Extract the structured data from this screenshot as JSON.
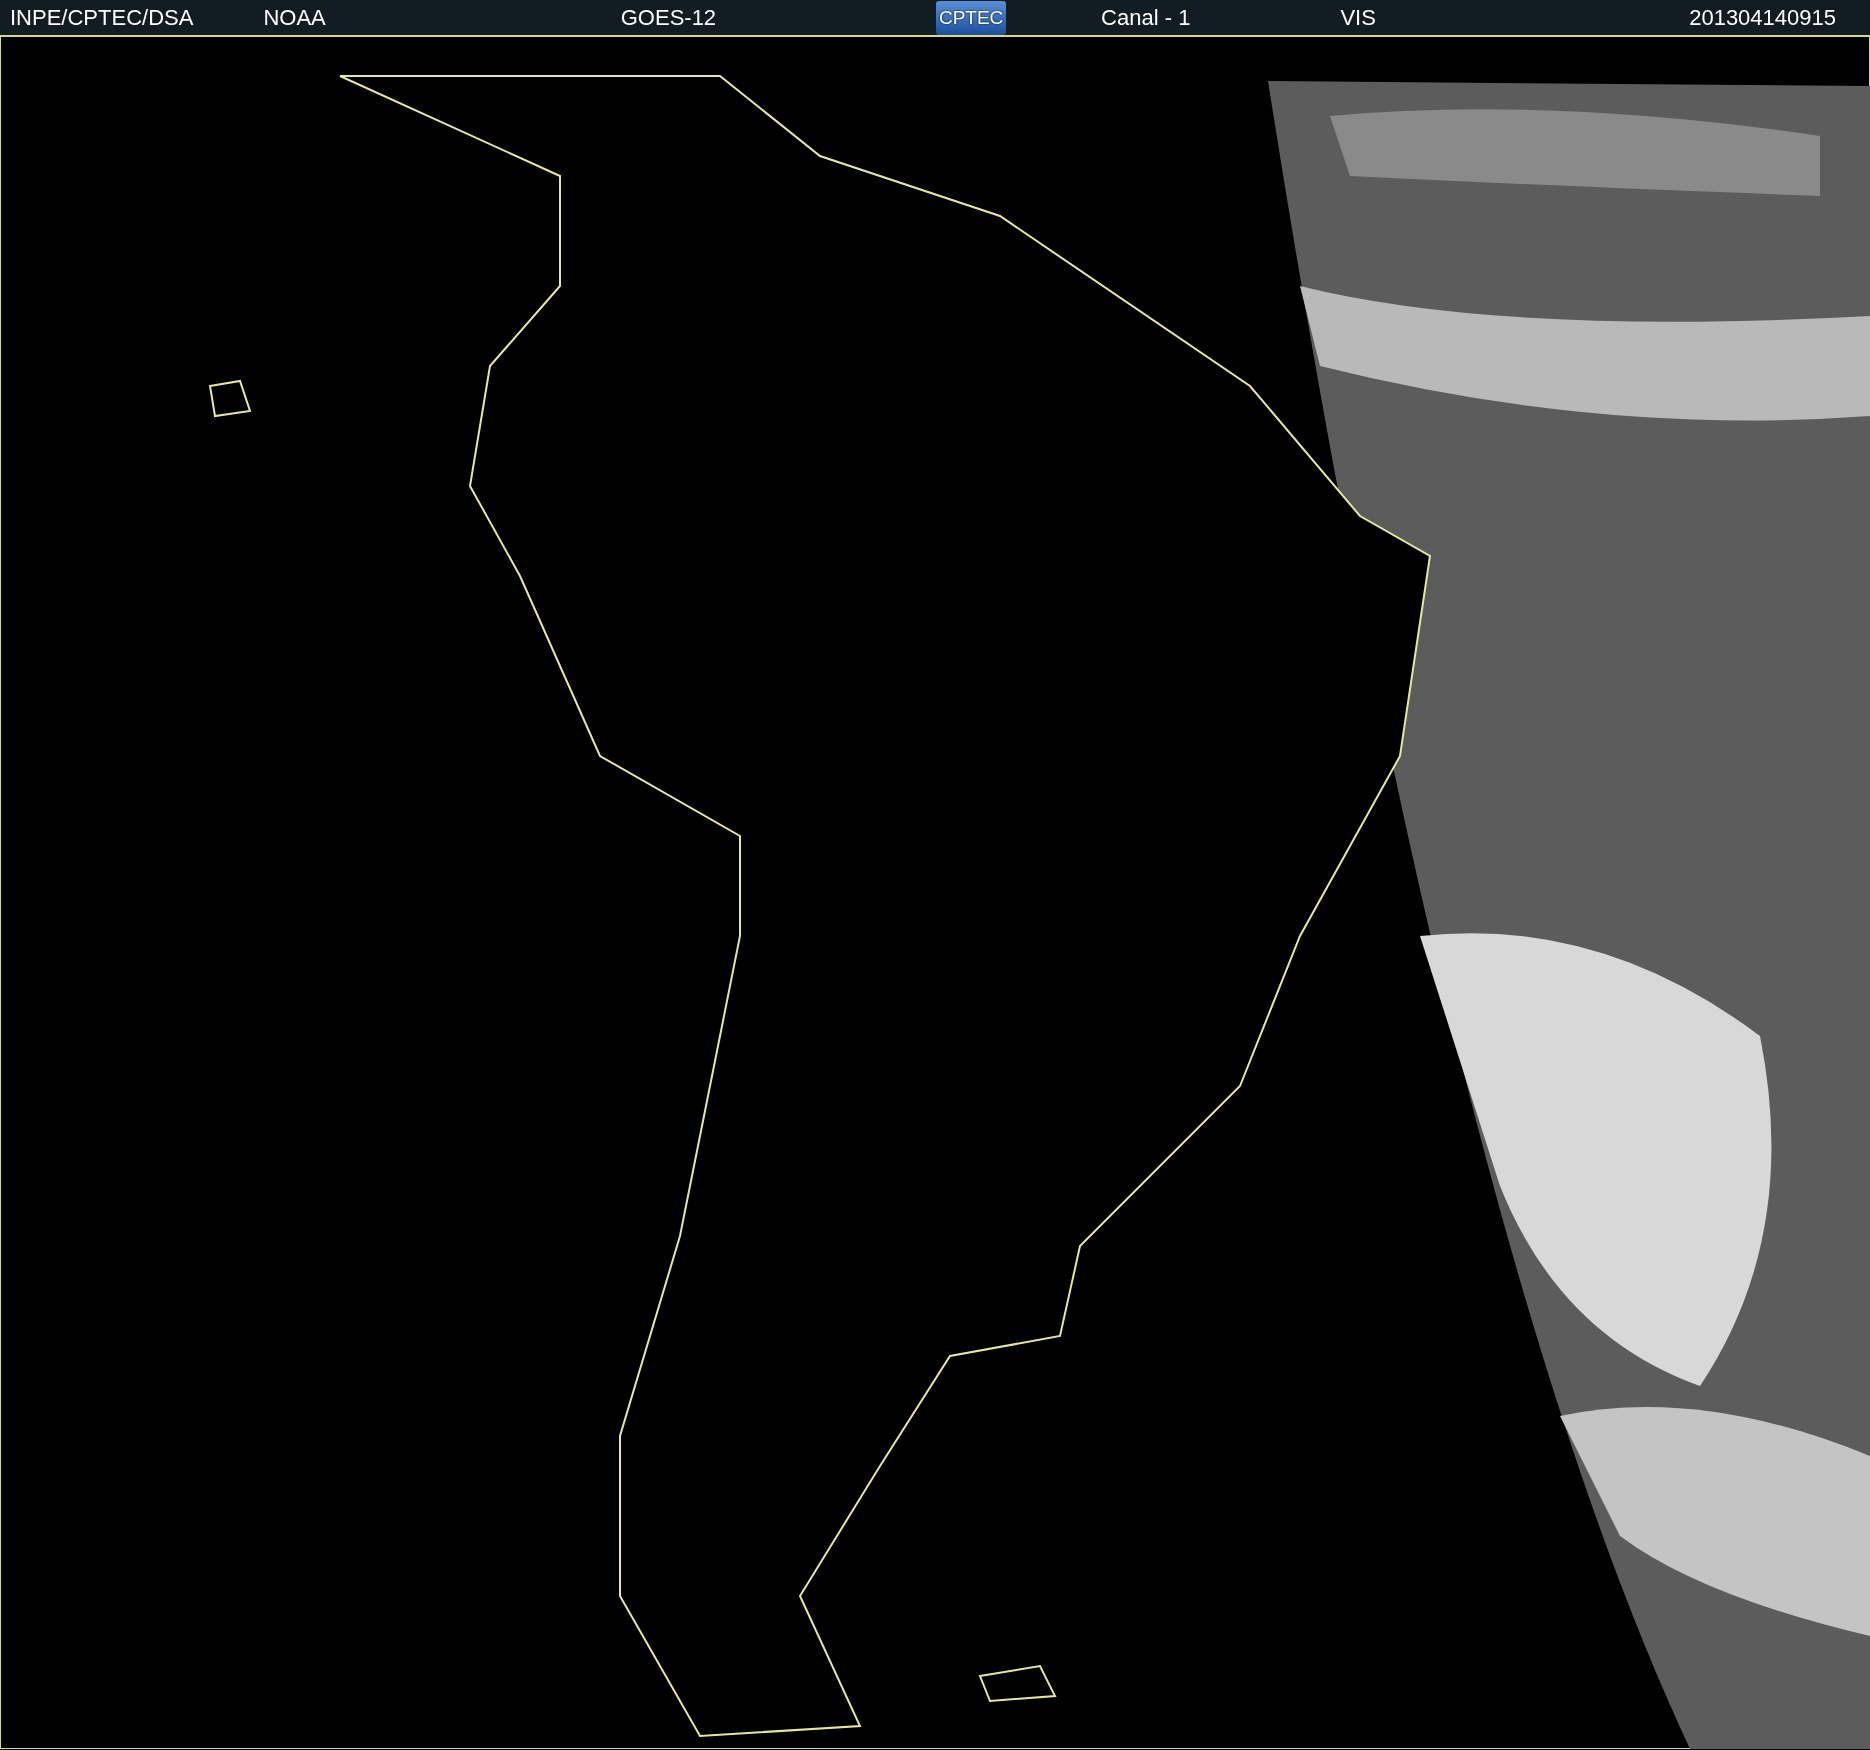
{
  "header": {
    "items": [
      {
        "kind": "text",
        "label": "INPE/CPTEC/DSA"
      },
      {
        "kind": "text",
        "label": "NOAA"
      },
      {
        "kind": "text",
        "label": "GOES-12"
      },
      {
        "kind": "logo",
        "label": "CPTEC"
      },
      {
        "kind": "text",
        "label": "Canal - 1"
      },
      {
        "kind": "text",
        "label": "VIS"
      },
      {
        "kind": "text",
        "label": "201304140915"
      }
    ]
  }
}
